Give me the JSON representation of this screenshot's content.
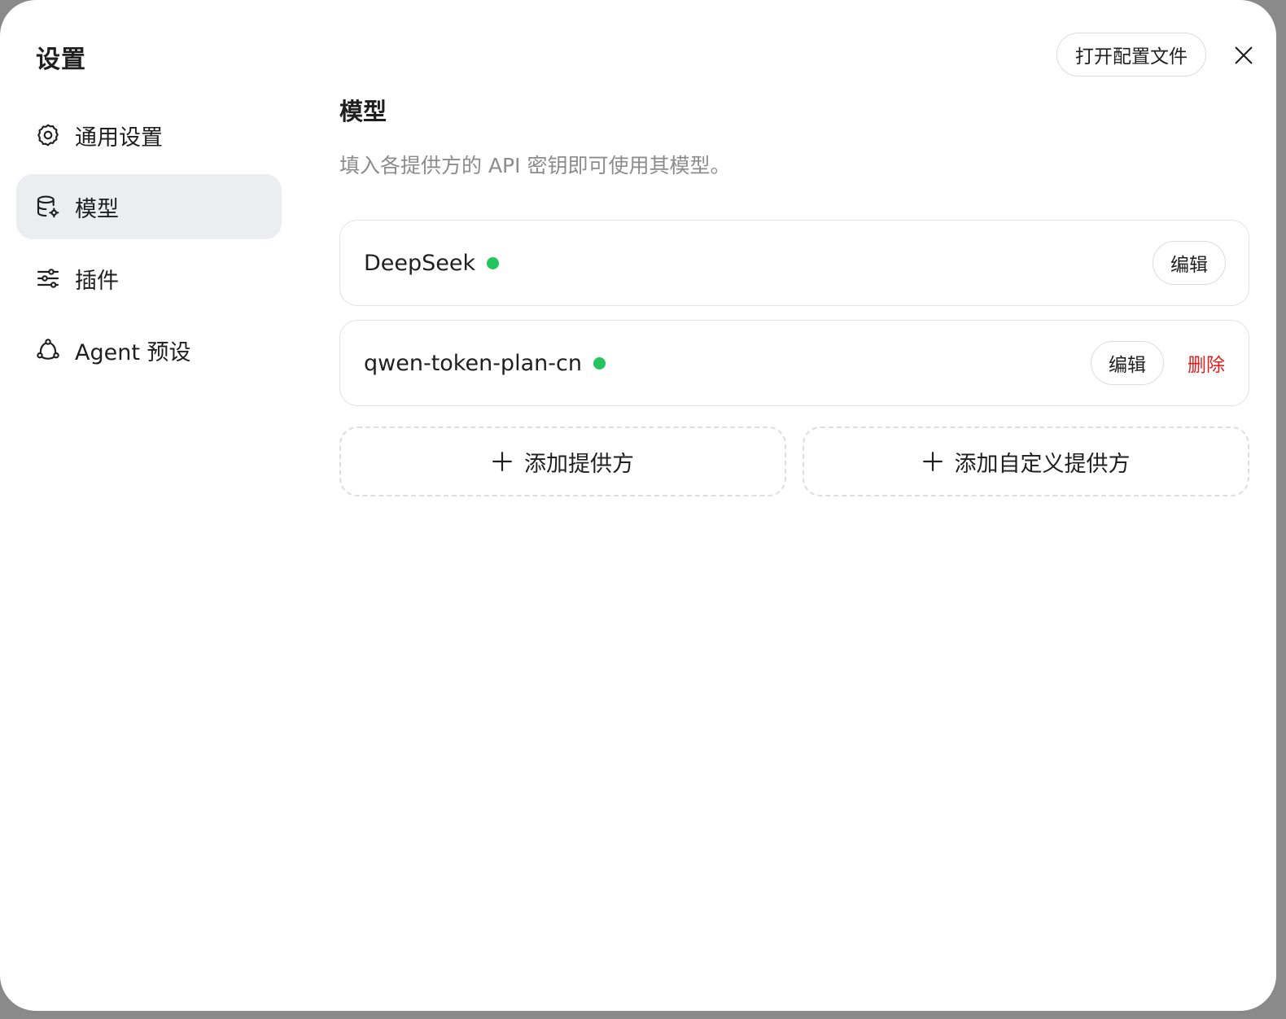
{
  "window": {
    "title": "设置"
  },
  "header": {
    "open_config_label": "打开配置文件"
  },
  "sidebar": {
    "items": [
      {
        "label": "通用设置",
        "icon": "gear-icon"
      },
      {
        "label": "模型",
        "icon": "database-gear-icon",
        "active": true
      },
      {
        "label": "插件",
        "icon": "sliders-icon"
      },
      {
        "label": "Agent 预设",
        "icon": "agent-network-icon"
      }
    ]
  },
  "main": {
    "title": "模型",
    "description": "填入各提供方的 API 密钥即可使用其模型。",
    "providers": [
      {
        "name": "DeepSeek",
        "status": "active",
        "edit_label": "编辑"
      },
      {
        "name": "qwen-token-plan-cn",
        "status": "active",
        "edit_label": "编辑",
        "delete_label": "删除"
      }
    ],
    "add_provider_label": "添加提供方",
    "add_custom_provider_label": "添加自定义提供方"
  },
  "colors": {
    "status_green": "#22c55e",
    "delete_red": "#e02020",
    "active_nav_bg": "#ecedf1"
  }
}
